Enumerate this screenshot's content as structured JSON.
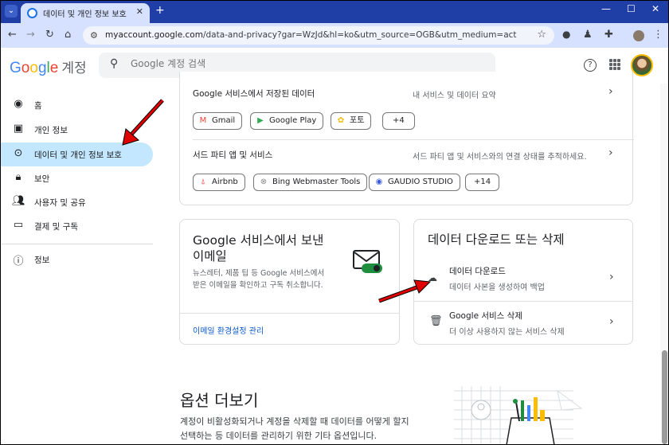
{
  "browser": {
    "tab_title": "데이터 및 개인 정보 보호",
    "tab_close": "✕",
    "new_tab": "+",
    "url_host": "myaccount.google.com",
    "url_path": "/data-and-privacy?gar=WzJd&hl=ko&utm_source=OGB&utm_medium=act",
    "window_controls": [
      "⌄",
      "—",
      "☐",
      "✕"
    ]
  },
  "header": {
    "logo_suffix": "계정",
    "search_placeholder": "Google 계정 검색"
  },
  "sidebar": {
    "items": [
      {
        "label": "홈",
        "icon": "account-circle-icon"
      },
      {
        "label": "개인 정보",
        "icon": "id-card-icon"
      },
      {
        "label": "데이터 및 개인 정보 보호",
        "icon": "toggle-icon"
      },
      {
        "label": "보안",
        "icon": "lock-icon"
      },
      {
        "label": "사용자 및 공유",
        "icon": "people-icon"
      },
      {
        "label": "결제 및 구독",
        "icon": "credit-card-icon"
      },
      {
        "label": "정보",
        "icon": "info-icon"
      }
    ]
  },
  "data_card": {
    "rows": [
      {
        "title": "Google 서비스에서 저장된 데이터",
        "desc": "내 서비스 및 데이터 요약",
        "chips": [
          "Gmail",
          "Google Play",
          "포토",
          "+4"
        ]
      },
      {
        "title": "서드 파티 앱 및 서비스",
        "desc": "서드 파티 앱 및 서비스와의 연결 상태를 추적하세요.",
        "chips": [
          "Airbnb",
          "Bing Webmaster Tools",
          "GAUDIO STUDIO",
          "+14"
        ]
      }
    ]
  },
  "email_card": {
    "title_line1": "Google 서비스에서 보낸",
    "title_line2": "이메일",
    "body_line1": "뉴스레터, 제품 팁 등 Google 서비스에서",
    "body_line2": "받은 이메일을 확인하고 구독 취소합니다.",
    "link": "이메일 환경설정 관리"
  },
  "download_card": {
    "title": "데이터 다운로드 또는 삭제",
    "rows": [
      {
        "title": "데이터 다운로드",
        "desc": "데이터 사본을 생성하여 백업"
      },
      {
        "title": "Google 서비스 삭제",
        "desc": "더 이상 사용하지 않는 서비스 삭제"
      }
    ]
  },
  "more_options": {
    "title": "옵션 더보기",
    "desc_line1": "계정이 비활성화되거나 계정을 삭제할 때 데이터를 어떻게 할지",
    "desc_line2": "선택하는 등 데이터를 관리하기 위한 기타 옵션입니다."
  },
  "colors": {
    "active_nav": "#c2e7ff",
    "browser_frame": "#1f3fa6",
    "link": "#0b57d0",
    "annotation_arrow": "#e00000"
  }
}
